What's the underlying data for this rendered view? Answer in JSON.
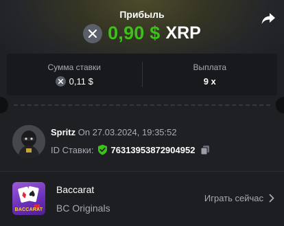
{
  "header": {
    "title": "Прибыль",
    "profit_amount": "0,90 $",
    "profit_currency": "XRP",
    "share_icon": "share-arrow-icon"
  },
  "stats": {
    "bet_label": "Сумма ставки",
    "bet_value": "0,11 $",
    "payout_label": "Выплата",
    "payout_value": "9 x",
    "coin_icon": "xrp-coin-icon"
  },
  "user": {
    "name": "Spritz",
    "date": "On 27.03.2024, 19:35:52",
    "bet_id_label": "ID Ставки:",
    "bet_id": "76313953872904952",
    "verified_icon": "shield-check-icon",
    "copy_icon": "copy-icon"
  },
  "game": {
    "name": "Baccarat",
    "provider": "BC Originals",
    "thumb_text": "BACCARAT",
    "play_label": "Играть сейчас"
  },
  "colors": {
    "accent_green": "#3bc117",
    "background": "#1e2024",
    "muted_text": "#a7abb3"
  }
}
